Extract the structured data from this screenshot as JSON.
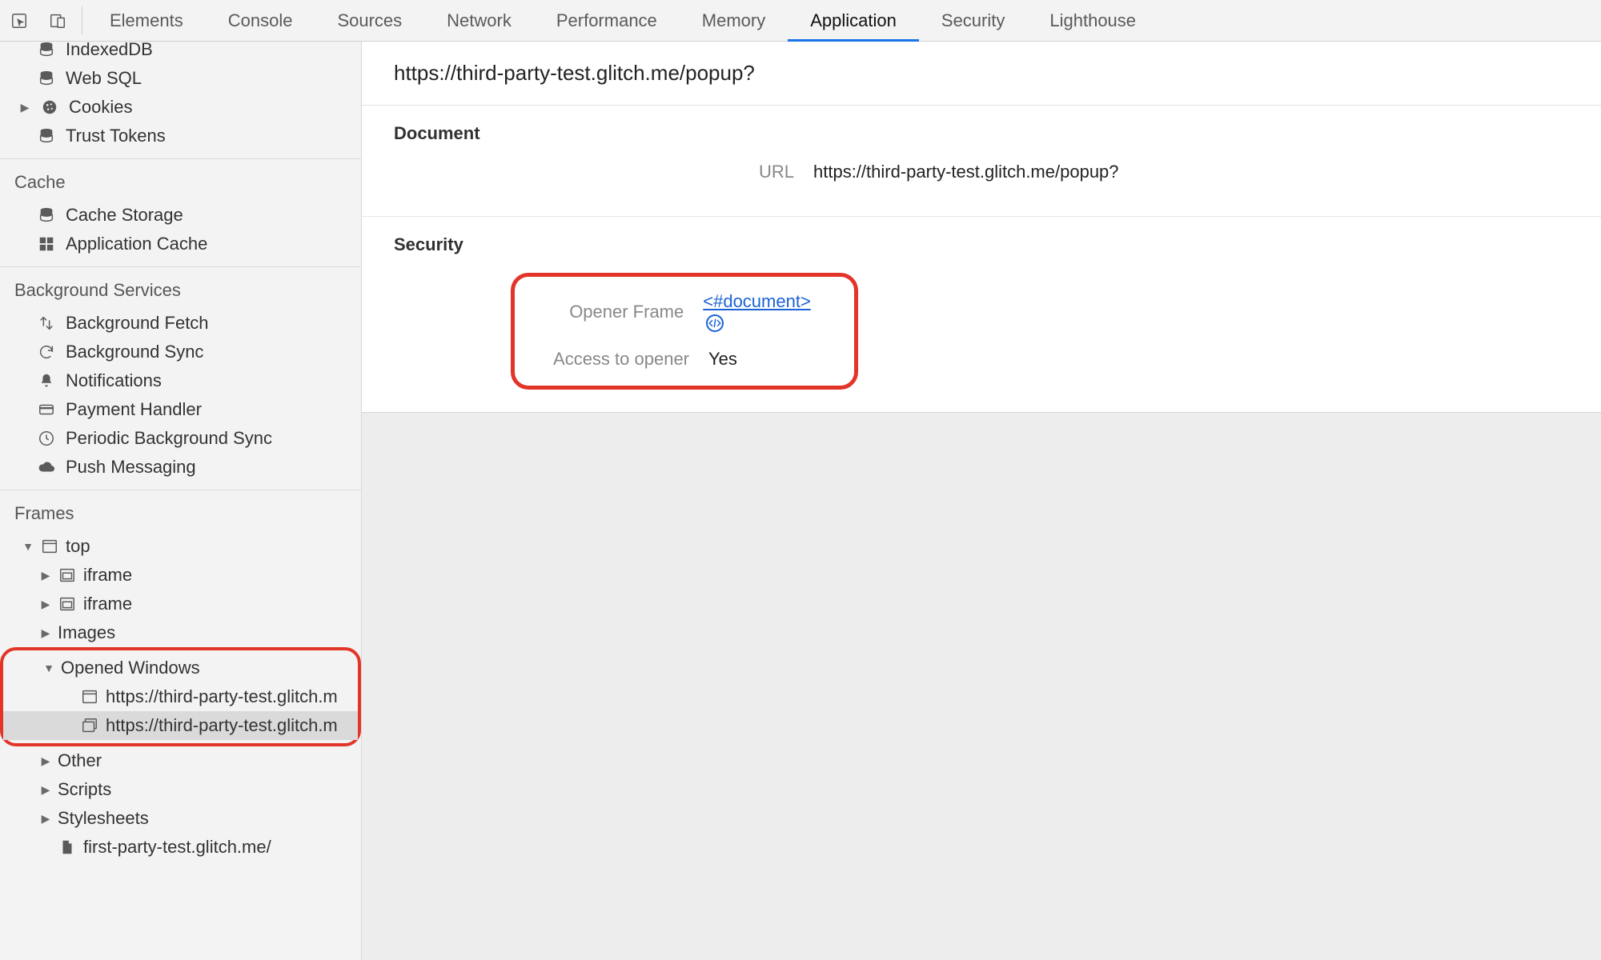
{
  "tabs": {
    "items": [
      "Elements",
      "Console",
      "Sources",
      "Network",
      "Performance",
      "Memory",
      "Application",
      "Security",
      "Lighthouse"
    ],
    "active_index": 6
  },
  "sidebar": {
    "storage": {
      "indexeddb": "IndexedDB",
      "websql": "Web SQL",
      "cookies": "Cookies",
      "trust_tokens": "Trust Tokens"
    },
    "cache": {
      "header": "Cache",
      "cache_storage": "Cache Storage",
      "app_cache": "Application Cache"
    },
    "bg": {
      "header": "Background Services",
      "fetch": "Background Fetch",
      "sync": "Background Sync",
      "notifications": "Notifications",
      "payment": "Payment Handler",
      "periodic": "Periodic Background Sync",
      "push": "Push Messaging"
    },
    "frames": {
      "header": "Frames",
      "top": "top",
      "iframe1": "iframe",
      "iframe2": "iframe",
      "images": "Images",
      "opened_windows": "Opened Windows",
      "ow_item1": "https://third-party-test.glitch.m",
      "ow_item2": "https://third-party-test.glitch.m",
      "other": "Other",
      "scripts": "Scripts",
      "stylesheets": "Stylesheets",
      "file1": "first-party-test.glitch.me/"
    }
  },
  "detail": {
    "title": "https://third-party-test.glitch.me/popup?",
    "document": {
      "header": "Document",
      "url_label": "URL",
      "url_value": "https://third-party-test.glitch.me/popup?"
    },
    "security": {
      "header": "Security",
      "opener_frame_label": "Opener Frame",
      "opener_frame_value": "<#document>",
      "access_label": "Access to opener",
      "access_value": "Yes"
    }
  }
}
